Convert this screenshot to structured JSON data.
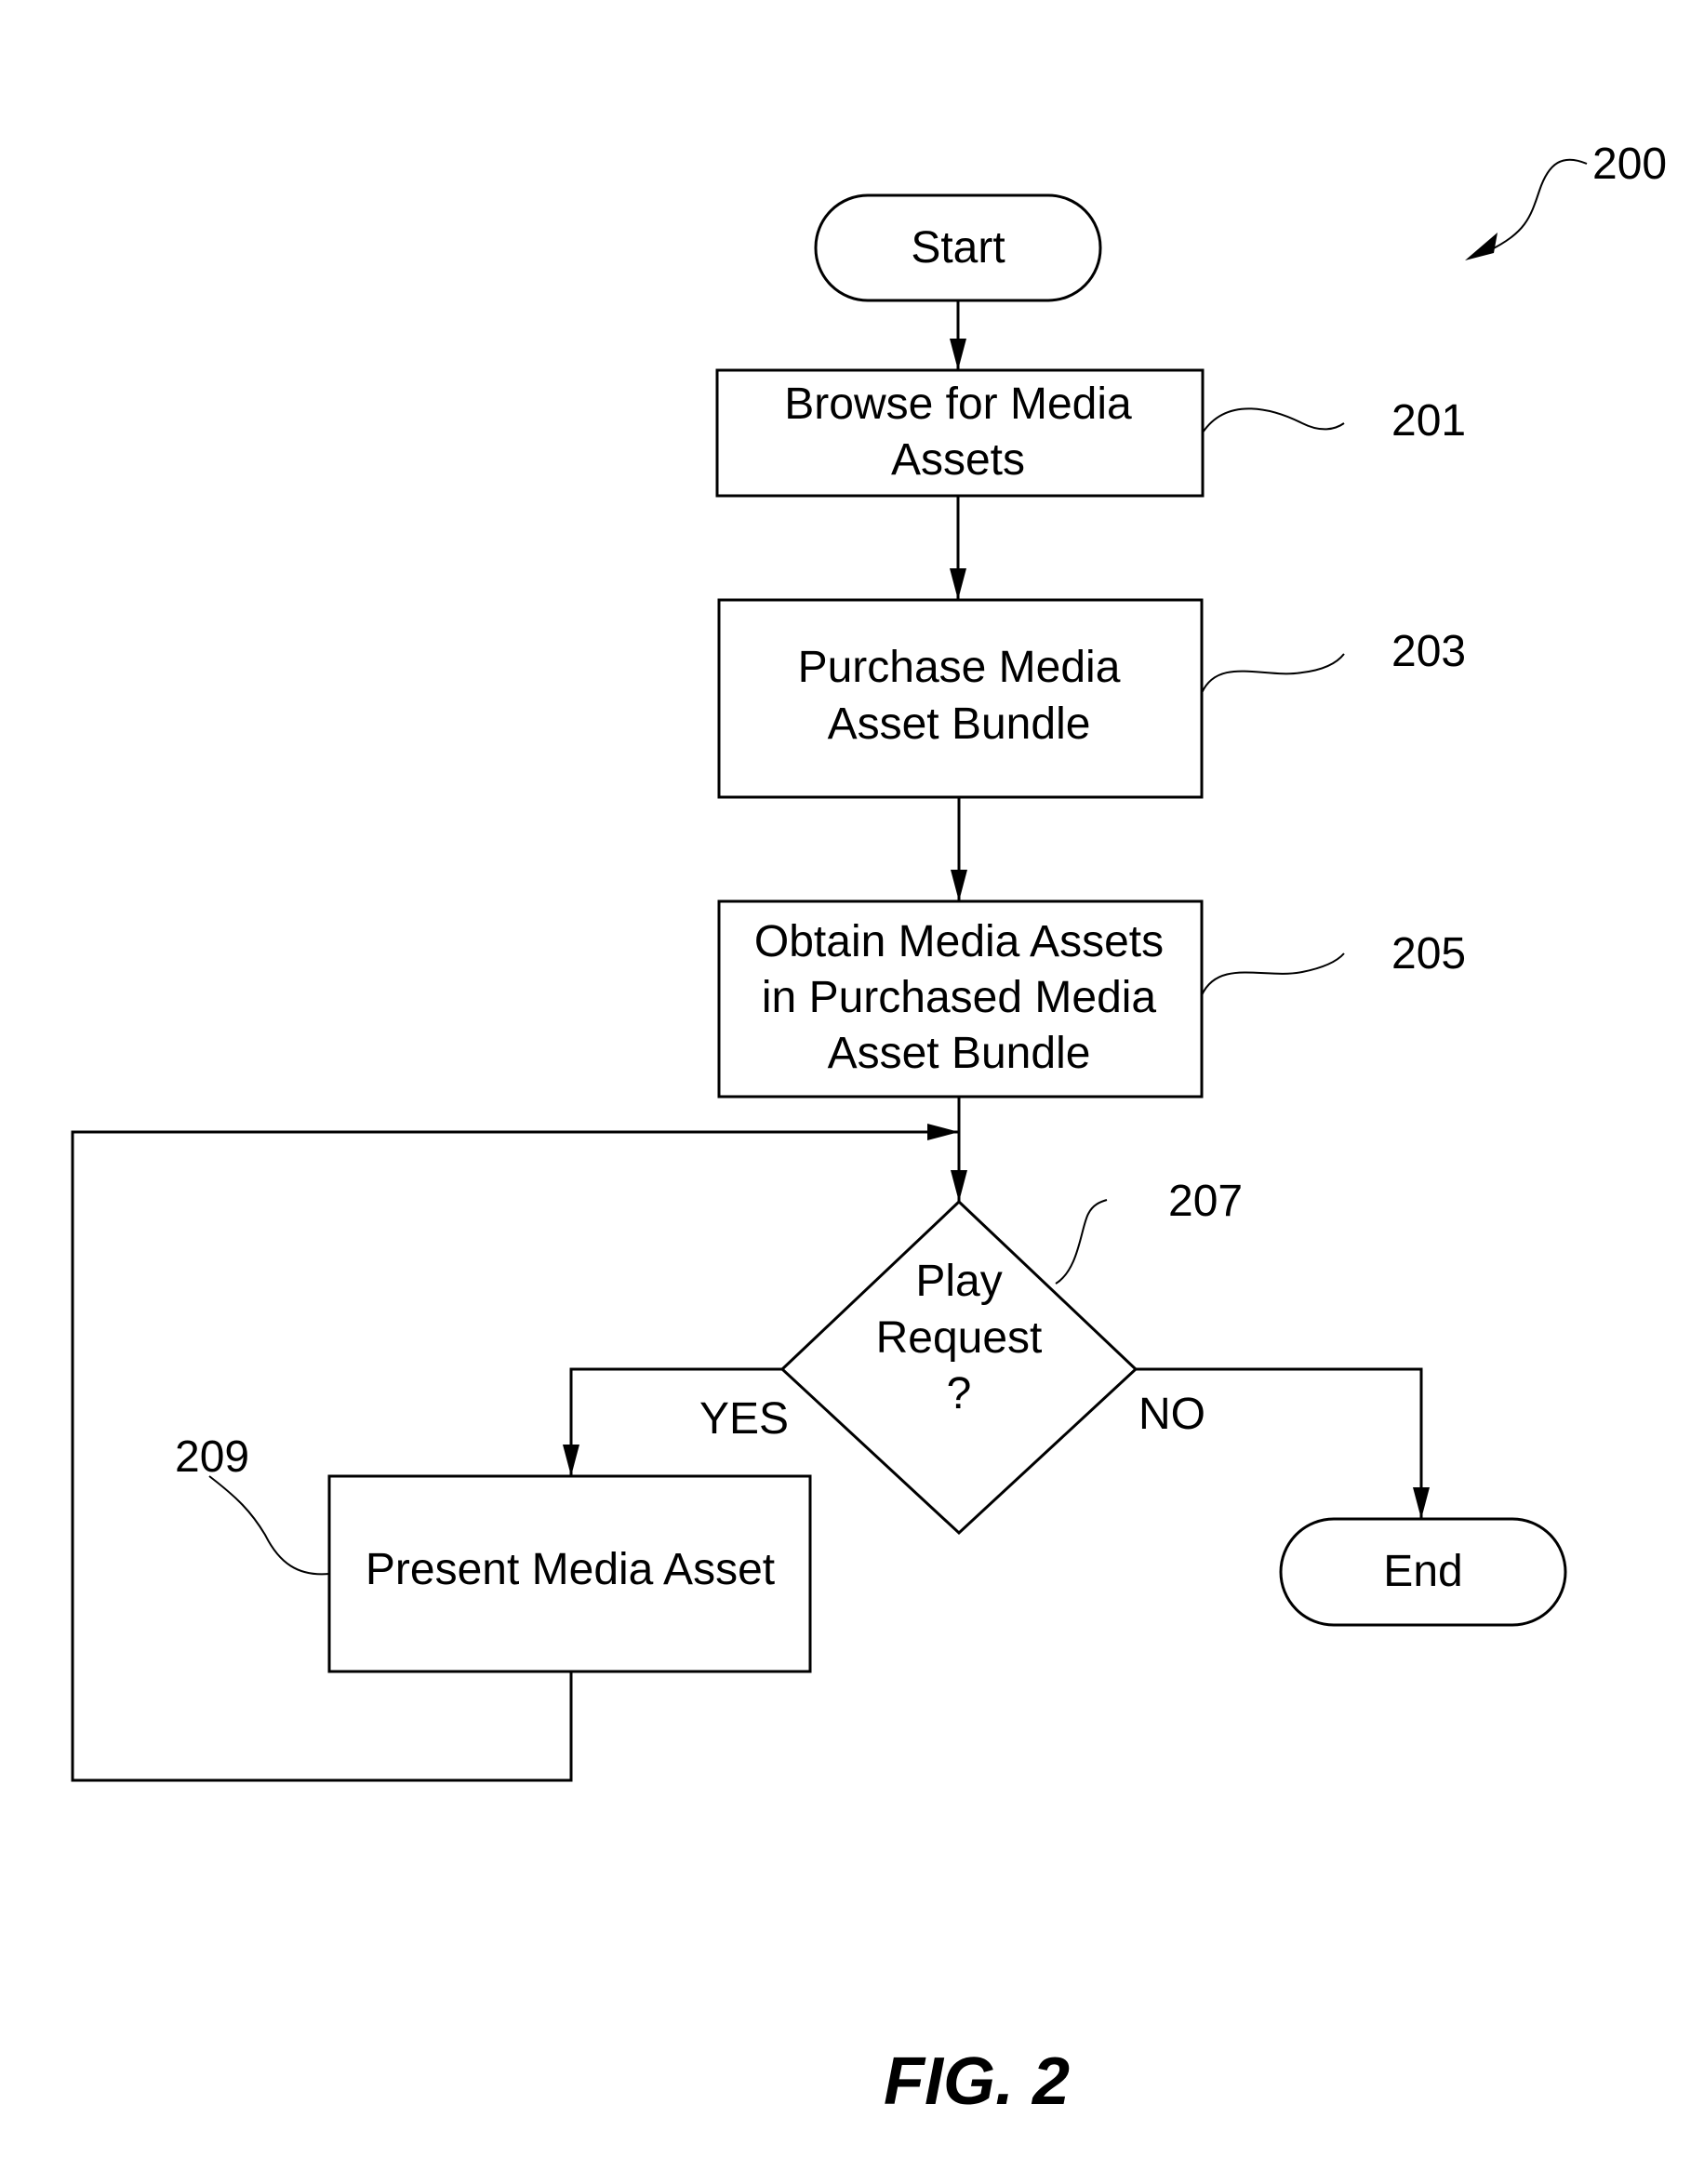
{
  "figure": {
    "ref_number": "200",
    "caption": "FIG. 2"
  },
  "nodes": {
    "start": {
      "type": "terminal",
      "lines": [
        "Start"
      ]
    },
    "browse": {
      "type": "process",
      "ref": "201",
      "lines": [
        "Browse for Media",
        "Assets"
      ]
    },
    "purchase": {
      "type": "process",
      "ref": "203",
      "lines": [
        "Purchase Media",
        "Asset Bundle"
      ]
    },
    "obtain": {
      "type": "process",
      "ref": "205",
      "lines": [
        "Obtain Media Assets",
        "in Purchased Media",
        "Asset Bundle"
      ]
    },
    "decision": {
      "type": "decision",
      "ref": "207",
      "lines": [
        "Play",
        "Request",
        "?"
      ]
    },
    "present": {
      "type": "process",
      "ref": "209",
      "lines": [
        "Present Media Asset"
      ]
    },
    "end": {
      "type": "terminal",
      "lines": [
        "End"
      ]
    }
  },
  "edges": [
    {
      "from": "start",
      "to": "browse",
      "label": ""
    },
    {
      "from": "browse",
      "to": "purchase",
      "label": ""
    },
    {
      "from": "purchase",
      "to": "obtain",
      "label": ""
    },
    {
      "from": "obtain",
      "to": "decision",
      "label": ""
    },
    {
      "from": "decision",
      "to": "present",
      "label": "YES"
    },
    {
      "from": "decision",
      "to": "end",
      "label": "NO"
    },
    {
      "from": "present",
      "to": "decision",
      "label": ""
    }
  ],
  "labels": {
    "yes": "YES",
    "no": "NO"
  }
}
